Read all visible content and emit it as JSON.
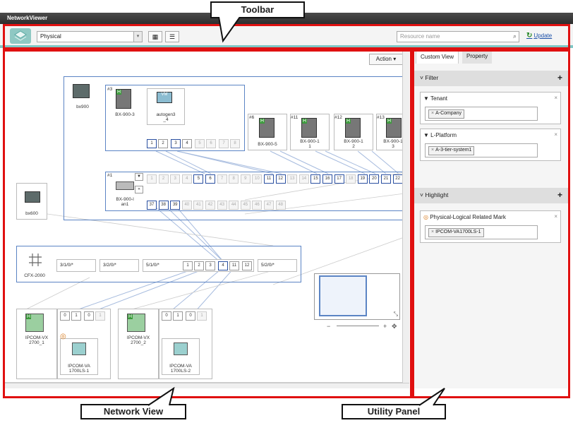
{
  "app": {
    "title": "NetworkViewer"
  },
  "toolbar": {
    "view_select": "Physical",
    "search_placeholder": "Resource name",
    "update_label": "Update",
    "grid_icon": "grid-icon",
    "list_icon": "list-icon"
  },
  "network": {
    "action_label": "Action",
    "chassis_label": "bx900",
    "bx600_label": "bx600",
    "switch_label": "CFX-2000",
    "server3": {
      "id": "#3",
      "name": "BX-900-3"
    },
    "vm": {
      "badge": "VM",
      "name": "autogen3\n_4"
    },
    "server5": {
      "id": "#6",
      "name": "BX-900-5"
    },
    "server11": {
      "id": "#11",
      "name": "BX-900-1\n1"
    },
    "server12": {
      "id": "#12",
      "name": "BX-900-1\n2"
    },
    "server13": {
      "id": "#13",
      "name": "BX-900-1\n3"
    },
    "lan": {
      "id": "#1",
      "name": "BX-900-l\nan1"
    },
    "server_ports": [
      "1",
      "2",
      "3",
      "4",
      "5",
      "6",
      "7",
      "8"
    ],
    "lan_ports_top": [
      "1",
      "2",
      "3",
      "4",
      "5",
      "6",
      "7",
      "8",
      "9",
      "10",
      "11",
      "12",
      "13",
      "14",
      "15",
      "16",
      "17",
      "18",
      "19",
      "20",
      "21",
      "22"
    ],
    "lan_ports_bottom": [
      "37",
      "38",
      "39",
      "40",
      "41",
      "42",
      "43",
      "44",
      "45",
      "46",
      "47",
      "48"
    ],
    "cfx_groups": [
      "3/1/0/*",
      "3/2/0/*",
      "5/1/0/*",
      "5/2/0/*"
    ],
    "cfx_ports": [
      "1",
      "2",
      "3",
      "4",
      "11",
      "12"
    ],
    "ipcom1": {
      "name": "IPCOM-VX\n2700_1",
      "ports": [
        "0",
        "1",
        "0",
        "1"
      ],
      "va": "IPCOM-VA\n1700LS-1"
    },
    "ipcom2": {
      "name": "IPCOM-VX\n2700_2",
      "ports": [
        "0",
        "1",
        "0",
        "1"
      ],
      "va": "IPCOM-VA\n1700LS-2"
    }
  },
  "utility": {
    "tabs": [
      "Custom View",
      "Property"
    ],
    "filter_label": "Filter",
    "tenant_label": "Tenant",
    "tenant_value": "A-Company",
    "lplatform_label": "L-Platform",
    "lplatform_value": "A-3-tier-system1",
    "highlight_label": "Highlight",
    "mark_label": "Physical-Logical Related Mark",
    "mark_value": "IPCOM-VA1700LS-1"
  },
  "annotations": {
    "toolbar": "Toolbar",
    "network_view": "Network View",
    "utility_panel": "Utility Panel"
  }
}
